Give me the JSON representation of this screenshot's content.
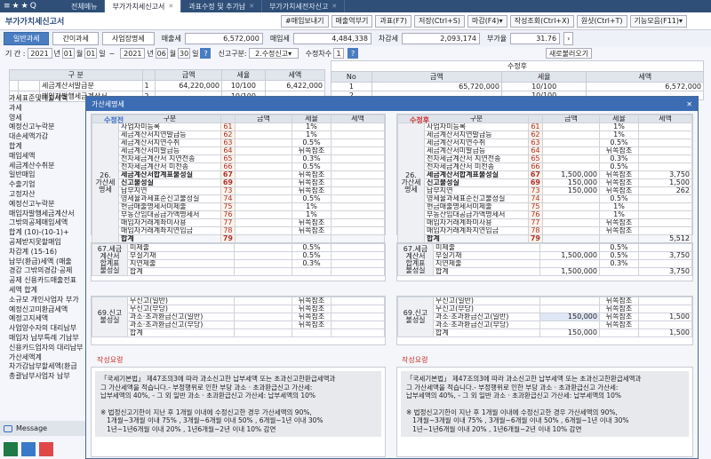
{
  "top": {
    "icons": [
      "≡",
      "★",
      "★",
      "Q"
    ],
    "tabs": [
      {
        "label": "전체메뉴",
        "active": false
      },
      {
        "label": "부가가치세신고서",
        "active": true
      },
      {
        "label": "과표수정 및 추가납",
        "active": false
      },
      {
        "label": "부가가치세전자신고",
        "active": false
      }
    ]
  },
  "titlebar": {
    "title": "부가가치세신고서",
    "buttons": [
      "#매입보내기",
      "매출역부기",
      "과표(F7)",
      "저장(Ctrl+S)",
      "마감(F4)",
      "작성조회(Ctrl+X)",
      "원샷(Ctrl+T)",
      "기능모음(F11)"
    ]
  },
  "subtabs": [
    "일반과세",
    "간이과세",
    "사업장명세"
  ],
  "summary": [
    {
      "label": "매출세",
      "value": "6,572,000"
    },
    {
      "label": "매입세",
      "value": "4,484,338"
    },
    {
      "label": "차감세",
      "value": "2,093,174"
    },
    {
      "label": "부가율",
      "value": "31.76"
    }
  ],
  "period": {
    "label": "기 간 :",
    "y1": "2021",
    "yl": "년",
    "m1": "01",
    "ml": "월",
    "d1": "01",
    "dl": "일",
    "tilde": "~",
    "y2": "2021",
    "m2": "06",
    "d2": "30",
    "type_label": "신고구분:",
    "type": "2.수정신고",
    "rev_label": "수정차수",
    "rev": "1",
    "reload": "새로불러오기"
  },
  "bg": {
    "left_header": [
      "구 분",
      "금액",
      "세율",
      "세액"
    ],
    "left_rows": [
      [
        "",
        "",
        "세금계산서발급분",
        "1",
        "64,220,000",
        "10/100",
        "6,422,000"
      ],
      [
        "",
        "",
        "매입자발행세금계산서",
        "2",
        "",
        "10/100",
        ""
      ],
      [
        "",
        "",
        "신용카드",
        "",
        "",
        "",
        ""
      ]
    ],
    "right_title": "수정후",
    "right_header": [
      "No",
      "금액",
      "세율",
      "세액"
    ],
    "right_rows": [
      [
        "1",
        "65,720,000",
        "10/100",
        "6,572,000"
      ],
      [
        "2",
        "",
        "10/100",
        ""
      ]
    ],
    "side_labels": [
      "과세표준및매출세액",
      "과세",
      "영세",
      "예정신고누락분",
      "대손세액가감",
      "합계",
      "매입세액",
      "세금계산수취분",
      "일반매입",
      "수출기업",
      "고정자산",
      "예정신고누락분",
      "매입자발행세금계산서",
      "그밖의공제매입세액",
      "합계 (10)-(10-1)+",
      "공제받지못할매입",
      "차감계 (15-16)",
      "납부(환급)세액 (매출",
      "경감 그밖의경감·공제",
      "공제 신용카드매출전표",
      "세액 합계",
      "소규모 개인사업자 부가",
      "예정신고미환급세액",
      "예정고지세액",
      "사업양수자의 대리납부",
      "매입자 납부특례 기납부",
      "신용카드업자의 대리납부",
      "가산세액계",
      "차가감납부할세액(환급",
      "총괄납부사업자 납부"
    ]
  },
  "modal": {
    "title": "가산세명세",
    "close": "✕",
    "left_caption": "수정전",
    "right_caption": "수정후",
    "header": [
      "구분",
      "금액",
      "세율",
      "세액"
    ],
    "group26": "26.\n가산세\n명세",
    "rows": [
      {
        "name": "사업자미등록",
        "no": "61",
        "rate": "1%",
        "bold": false
      },
      {
        "name": "세금계산서지연발급등",
        "no": "62",
        "rate": "1%",
        "bold": false
      },
      {
        "name": "세금계산서지연수취",
        "no": "63",
        "rate": "0.5%",
        "bold": false
      },
      {
        "name": "세금계산서미발급등",
        "no": "64",
        "rate": "뒤쪽참조",
        "bold": false
      },
      {
        "name": "전자세금계산서 지연전송",
        "no": "65",
        "rate": "0.3%",
        "bold": false
      },
      {
        "name": "전자세금계산서 미전송",
        "no": "66",
        "rate": "0.5%",
        "bold": false
      },
      {
        "name": "세금계산서합계표불성실",
        "no": "67",
        "rate": "뒤쪽참조",
        "bold": true
      },
      {
        "name": "신고불성실",
        "no": "69",
        "rate": "뒤쪽참조",
        "bold": true
      },
      {
        "name": "납부지연",
        "no": "73",
        "rate": "뒤쪽참조",
        "bold": false
      },
      {
        "name": "영세율과세표준신고불성실",
        "no": "74",
        "rate": "0.5%",
        "bold": false
      },
      {
        "name": "현금매출명세서미제출",
        "no": "75",
        "rate": "1%",
        "bold": false
      },
      {
        "name": "부동산임대공급가액명세서",
        "no": "76",
        "rate": "1%",
        "bold": false
      },
      {
        "name": "매입자거래계좌미사용",
        "no": "77",
        "rate": "뒤쪽참조",
        "bold": false
      },
      {
        "name": "매입자거래계좌지연입금",
        "no": "78",
        "rate": "뒤쪽참조",
        "bold": false
      },
      {
        "name": "합계",
        "no": "79",
        "rate": "",
        "bold": true
      }
    ],
    "right_amounts": [
      "",
      "",
      "",
      "",
      "",
      "",
      "1,500,000",
      "150,000",
      "150,000",
      "",
      "",
      "",
      "",
      "",
      ""
    ],
    "right_taxes": [
      "",
      "",
      "",
      "",
      "",
      "",
      "3,750",
      "1,500",
      "262",
      "",
      "",
      "",
      "",
      "",
      "5,512"
    ],
    "group67": "67.세금\n계산서\n합계표\n불성실",
    "rows67": [
      {
        "name": "미제출",
        "rate": "0.5%"
      },
      {
        "name": "부실기재",
        "rate": "0.5%"
      },
      {
        "name": "지연제출",
        "rate": "0.3%"
      },
      {
        "name": "합계",
        "rate": ""
      }
    ],
    "r67_amounts": [
      "",
      "1,500,000",
      "",
      "1,500,000"
    ],
    "r67_taxes": [
      "",
      "3,750",
      "",
      "3,750"
    ],
    "group69": "69.신고\n불성실",
    "rows69": [
      {
        "name": "무신고(일반)",
        "rate": "뒤쪽참조"
      },
      {
        "name": "무신고(부당)",
        "rate": "뒤쪽참조"
      },
      {
        "name": "과소·초과환급신고(일반)",
        "rate": "뒤쪽참조"
      },
      {
        "name": "과소·초과환급신고(부당)",
        "rate": "뒤쪽참조"
      },
      {
        "name": "합계",
        "rate": ""
      }
    ],
    "r69_amounts": [
      "",
      "",
      "150,000",
      "",
      "150,000"
    ],
    "r69_taxes": [
      "",
      "",
      "1,500",
      "",
      "1,500"
    ],
    "note_title": "작성요령",
    "note_lines": [
      "「국세기본법」 제47조의3에 따라 과소신고한 납부세액 또는 초과신고한환급세액과",
      "그 가산세액을 적습니다.- 부정행위로 인한 부당 과소 · 초과환급신고 가산세:",
      "납부세액의 40%, - 그 외 일반 과소 · 초과환급신고 가산세: 납부세액의 10%",
      "",
      "※ 법정신고기한이 지난 후 1개월 이내에 수정신고한 경우 가산세액의 90%,",
      "   1개월~3개월 이내 75% , 3개월~6개월 이내 50% , 6개월~1년 이내 30%",
      "   1년~1년6개월 이내 20% , 1년6개월~2년 이내 10% 감면"
    ]
  },
  "taskbar": {
    "message": "Message"
  }
}
